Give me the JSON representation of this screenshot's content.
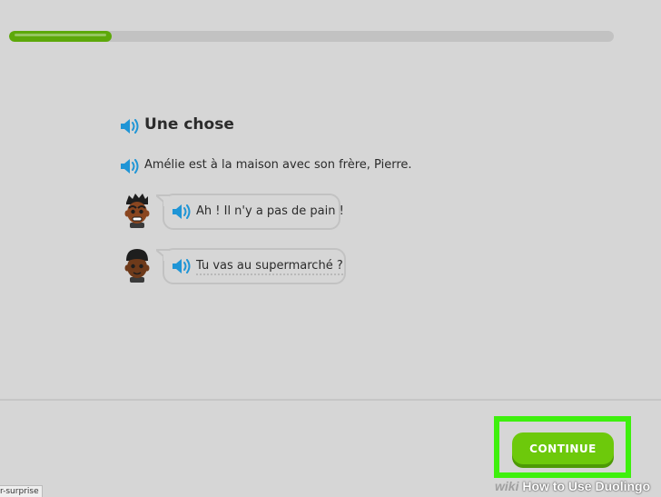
{
  "progress": {
    "fraction": 0.17,
    "fill_color": "#5da80a"
  },
  "story": {
    "title": "Une chose",
    "narration": "Amélie est à la maison avec son frère, Pierre.",
    "messages": [
      {
        "text": "Ah ! Il n'y a pas de pain !"
      },
      {
        "text": "Tu vas au supermarché ?"
      }
    ]
  },
  "footer": {
    "continue_label": "CONTINUE",
    "button_color": "#6dc90b",
    "highlight_color": "#3ef00d"
  },
  "status_tag": "r-surprise",
  "watermark": {
    "brand": "wiki",
    "text": "How to Use Duolingo"
  }
}
